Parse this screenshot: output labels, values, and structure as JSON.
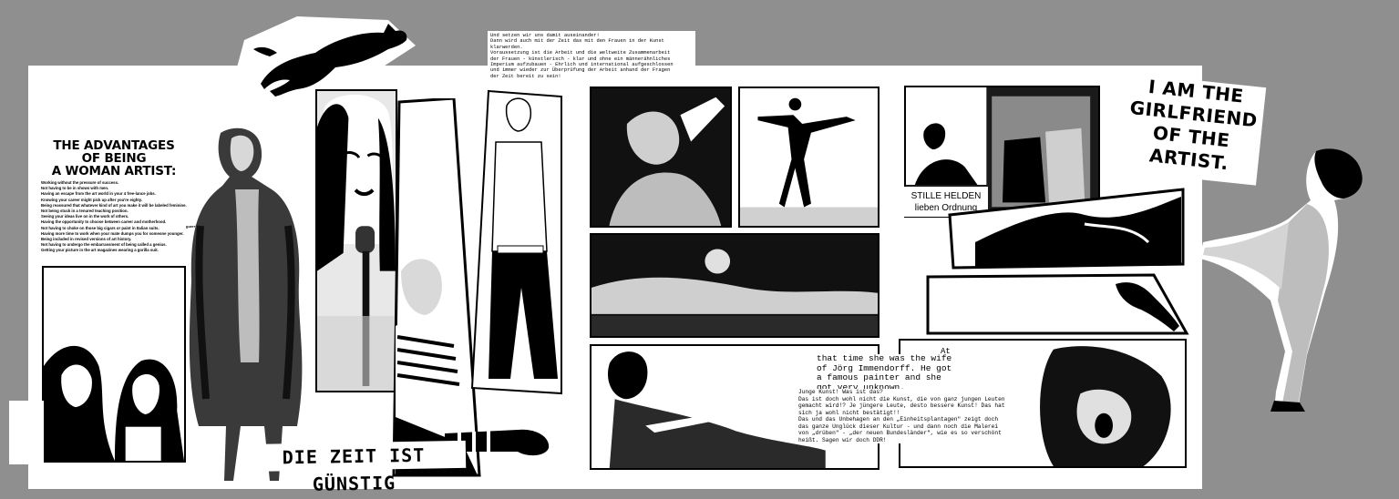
{
  "left": {
    "title_lines": [
      "THE ADVANTAGES",
      "OF BEING",
      "A WOMAN ARTIST:"
    ],
    "advantages": [
      "Working without the pressure of success.",
      "Not having to be in shows with men.",
      "Having an escape from the art world in your 4 free-lance jobs.",
      "Knowing your career might pick up after you're eighty.",
      "Being reassured that whatever kind of art you make it will be labeled feminine.",
      "Not being stuck in a tenured teaching position.",
      "Seeing your ideas live on in the work of others.",
      "Having the opportunity to choose between career and motherhood.",
      "Not having to choke on those big cigars or paint in Italian suits.",
      "Having more time to work when your mate dumps you for someone younger.",
      "Being included in revised versions of art history.",
      "Not having to undergo the embarrassment of being called a genius.",
      "Getting your picture in the art magazines wearing a gorilla suit."
    ],
    "side_note": "guerrilla girls",
    "banner": "DIE ZEIT IST GÜNSTIG"
  },
  "center": {
    "note": "Und setzen wir uns damit auseinander!\nDann wird auch mit der Zeit das mit den Frauen in der Kunst\nklarwerden.\nVoraussetzung ist die Arbeit und die weltweite Zusammenarbeit\nder Frauen - künstlerisch - klar und ohne ein männerähnliches\nImperium aufzubauen - Ehrlich und international aufgeschlossen\nund immer wieder zur Überprüfung der Arbeit anhand der Fragen\nder Zeit bereit zu sein!"
  },
  "right": {
    "girlfriend_lines": [
      "I AM THE",
      "GIRLFRIEND",
      "OF THE ARTIST."
    ],
    "caption_top": "STILLE HELDEN",
    "caption_bottom": "lieben Ordnung",
    "ji_at": "At",
    "ji_lead": "that time she was the wife of Jörg Immendorff. He got a famous painter and she got very unknown.",
    "ji_body": "Junge Kunst! Was ist das?\nDas ist doch wohl nicht die Kunst, die von ganz jungen Leuten\ngemacht wird!? Je jüngere Leute, desto bessere Kunst! Das hat\nsich ja wohl nicht bestätigt!!\nDas und das Unbehagen an den „Einheitsplantagen\" zeigt doch\ndas ganze Unglück dieser Kultur - und dann noch die Malerei\nvon „drüben\" - „der neuen Bundesländer\", wie es so verschönt\nheißt. Sagen wir doch DDR!"
  },
  "colors": {
    "background": "#8f8f8f",
    "sheet": "#ffffff",
    "ink": "#000000"
  },
  "icons": [
    "cat-silhouette",
    "shoe-silhouette"
  ]
}
